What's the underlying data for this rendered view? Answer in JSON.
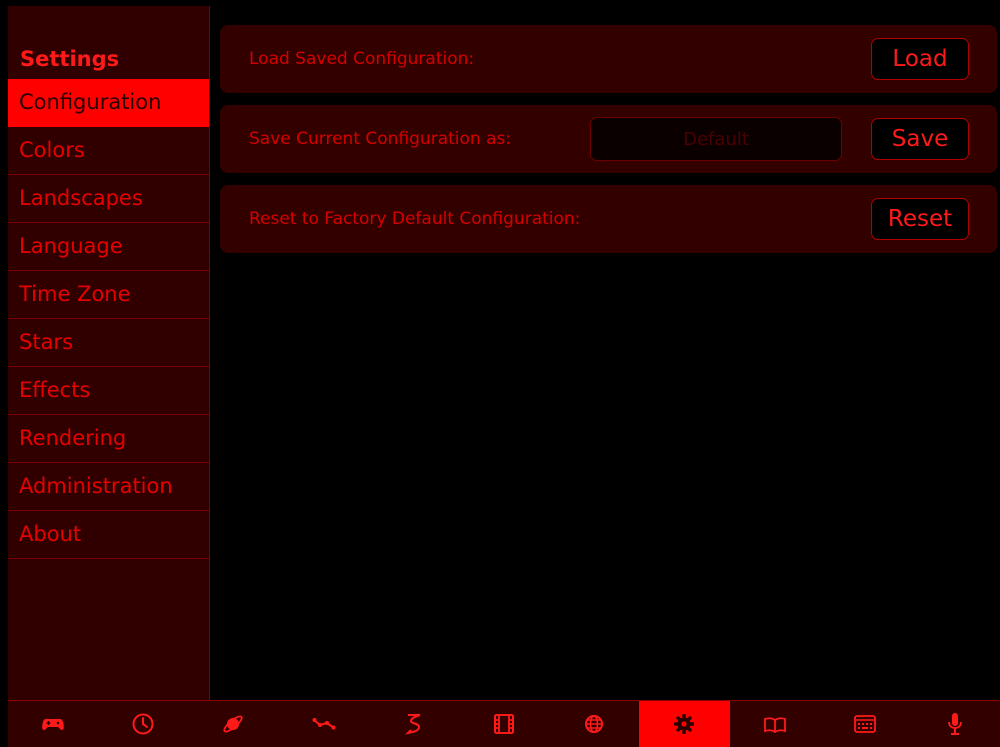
{
  "sidebar": {
    "title": "Settings",
    "items": [
      {
        "label": "Configuration",
        "active": true
      },
      {
        "label": "Colors"
      },
      {
        "label": "Landscapes"
      },
      {
        "label": "Language"
      },
      {
        "label": "Time Zone"
      },
      {
        "label": "Stars"
      },
      {
        "label": "Effects"
      },
      {
        "label": "Rendering"
      },
      {
        "label": "Administration"
      },
      {
        "label": "About"
      }
    ]
  },
  "main": {
    "load": {
      "label": "Load Saved Configuration:",
      "button": "Load"
    },
    "save": {
      "label": "Save Current Configuration as:",
      "placeholder": "Default",
      "value": "",
      "button": "Save"
    },
    "reset": {
      "label": "Reset to Factory Default Configuration:",
      "button": "Reset"
    }
  },
  "toolbar": {
    "icons": [
      "gamepad-icon",
      "clock-icon",
      "planet-icon",
      "constellation-icon",
      "path-icon",
      "film-icon",
      "globe-icon",
      "gear-icon",
      "book-icon",
      "keyboard-icon",
      "microphone-icon"
    ],
    "active": "gear-icon"
  },
  "colors": {
    "background": "#000000",
    "panel": "#330000",
    "accent": "#ff0000",
    "text": "#e60000"
  }
}
